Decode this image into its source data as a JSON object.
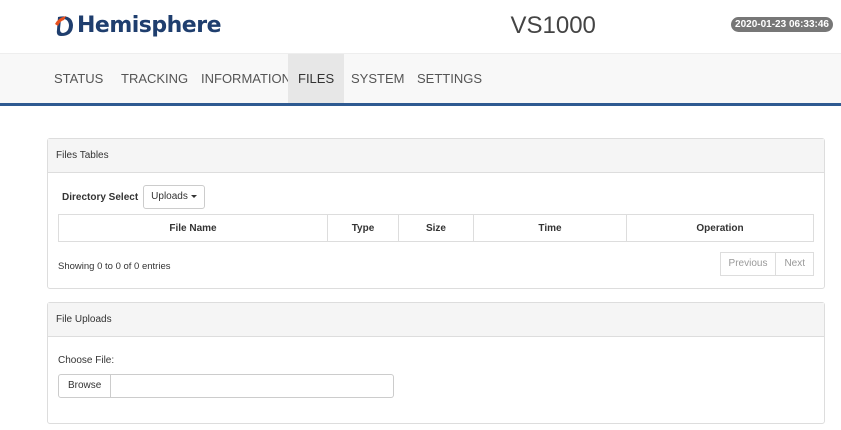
{
  "header": {
    "brand": "Hemisphere",
    "title": "VS1000",
    "datetime": "2020-01-23 06:33:46"
  },
  "nav": [
    "STATUS",
    "TRACKING",
    "INFORMATION",
    "FILES",
    "SYSTEM",
    "SETTINGS"
  ],
  "active_tab": "FILES",
  "files_panel": {
    "title": "Files Tables",
    "directory_label": "Directory Select",
    "directory_value": "Uploads",
    "columns": [
      "File Name",
      "Type",
      "Size",
      "Time",
      "Operation"
    ],
    "info": "Showing 0 to 0 of 0 entries",
    "previous": "Previous",
    "next": "Next"
  },
  "upload_panel": {
    "title": "File Uploads",
    "choose_label": "Choose File:",
    "browse": "Browse"
  },
  "colors": {
    "brand": "#1f3e6e",
    "logo_accent": "#e8501d",
    "nav_border": "#2e5a91"
  }
}
